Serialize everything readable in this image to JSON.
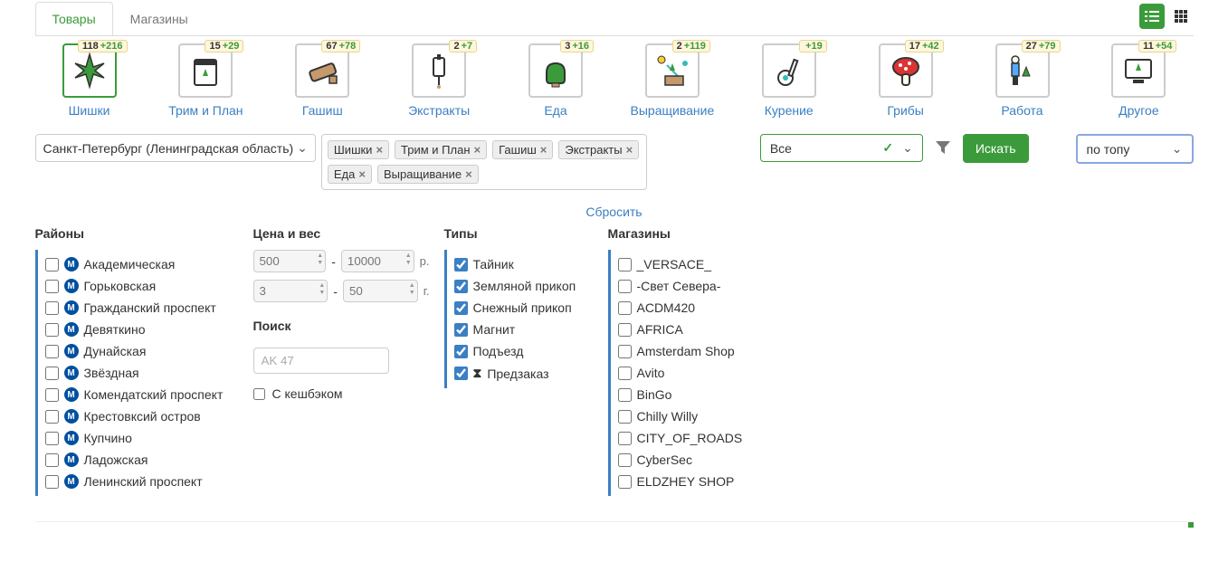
{
  "tabs": {
    "products": "Товары",
    "shops": "Магазины"
  },
  "categories": [
    {
      "label": "Шишки",
      "badge_main": "118",
      "badge_plus": "+216",
      "active": true
    },
    {
      "label": "Трим и План",
      "badge_main": "15",
      "badge_plus": "+29"
    },
    {
      "label": "Гашиш",
      "badge_main": "67",
      "badge_plus": "+78"
    },
    {
      "label": "Экстракты",
      "badge_main": "2",
      "badge_plus": "+7"
    },
    {
      "label": "Еда",
      "badge_main": "3",
      "badge_plus": "+16"
    },
    {
      "label": "Выращивание",
      "badge_main": "2",
      "badge_plus": "+119"
    },
    {
      "label": "Курение",
      "badge_main": "",
      "badge_plus": "+19"
    },
    {
      "label": "Грибы",
      "badge_main": "17",
      "badge_plus": "+42"
    },
    {
      "label": "Работа",
      "badge_main": "27",
      "badge_plus": "+79"
    },
    {
      "label": "Другое",
      "badge_main": "11",
      "badge_plus": "+54"
    }
  ],
  "city": "Санкт-Петербург (Ленинградская область)",
  "tags": [
    "Шишки",
    "Трим и План",
    "Гашиш",
    "Экстракты",
    "Еда",
    "Выращивание"
  ],
  "all_dropdown": "Все",
  "sort_dropdown": "по топу",
  "search_button": "Искать",
  "reset": "Сбросить",
  "headers": {
    "rayons": "Районы",
    "price": "Цена и вес",
    "search": "Поиск",
    "types": "Типы",
    "shops": "Магазины"
  },
  "rayons": [
    "Академическая",
    "Горьковская",
    "Гражданский проспект",
    "Девяткино",
    "Дунайская",
    "Звёздная",
    "Комендатский проспект",
    "Крестовксий остров",
    "Купчино",
    "Ладожская",
    "Ленинский проспект"
  ],
  "metro_letter": "М",
  "price": {
    "min": "500",
    "max": "10000",
    "unit_p": "р.",
    "wmin": "3",
    "wmax": "50",
    "unit_g": "г."
  },
  "search_placeholder": "AK 47",
  "cashback_label": "С кешбэком",
  "types": [
    {
      "label": "Тайник",
      "checked": true
    },
    {
      "label": "Земляной прикоп",
      "checked": true
    },
    {
      "label": "Снежный прикоп",
      "checked": true
    },
    {
      "label": "Магнит",
      "checked": true
    },
    {
      "label": "Подъезд",
      "checked": true
    },
    {
      "label": "Предзаказ",
      "checked": true,
      "hourglass": true
    }
  ],
  "shops": [
    "_VERSACE_",
    "-Свет Севера-",
    "ACDM420",
    "AFRICA",
    "Amsterdam Shop",
    "Avito",
    "BinGo",
    "Chilly Willy",
    "CITY_OF_ROADS",
    "CyberSec",
    "ELDZHEY SHOP"
  ]
}
